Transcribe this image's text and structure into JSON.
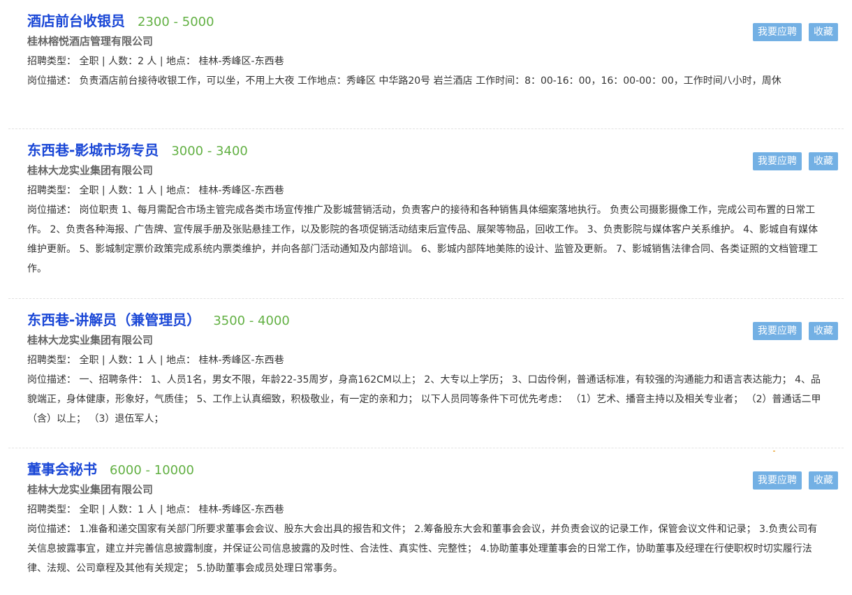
{
  "jobs": [
    {
      "title": "酒店前台收银员",
      "salary": "2300 - 5000",
      "company": "桂林榕悦酒店管理有限公司",
      "meta": "招聘类型： 全职 | 人数：2 人 | 地点： 桂林-秀峰区-东西巷",
      "desc": "岗位描述： 负责酒店前台接待收银工作，可以坐，不用上大夜 工作地点：秀峰区 中华路20号 岩兰酒店 工作时间：8：00-16：00，16：00-00：00，工作时间八小时，周休",
      "apply_label": "我要应聘",
      "save_label": "收藏"
    },
    {
      "title": "东西巷-影城市场专员",
      "salary": "3000 - 3400",
      "company": "桂林大龙实业集团有限公司",
      "meta": "招聘类型： 全职 | 人数：1 人 | 地点： 桂林-秀峰区-东西巷",
      "desc": "岗位描述： 岗位职责 1、每月需配合市场主管完成各类市场宣传推广及影城营销活动，负责客户的接待和各种销售具体细案落地执行。 负责公司摄影摄像工作，完成公司布置的日常工作。 2、负责各种海报、广告牌、宣传展手册及张贴悬挂工作，以及影院的各项促销活动结束后宣传品、展架等物品，回收工作。 3、负责影院与媒体客户关系维护。 4、影城自有媒体维护更新。 5、影城制定票价政策完成系统内票类维护，并向各部门活动通知及内部培训。 6、影城内部阵地美陈的设计、监管及更新。 7、影城销售法律合同、各类证照的文档管理工作。",
      "apply_label": "我要应聘",
      "save_label": "收藏"
    },
    {
      "title": "东西巷-讲解员（兼管理员）",
      "salary": "3500 - 4000",
      "company": "桂林大龙实业集团有限公司",
      "meta": "招聘类型： 全职 | 人数：1 人 | 地点： 桂林-秀峰区-东西巷",
      "desc": "岗位描述： 一、招聘条件： 1、人员1名，男女不限，年龄22-35周岁，身高162CM以上； 2、大专以上学历； 3、口齿伶俐，普通话标准，有较强的沟通能力和语言表达能力； 4、品貌端正，身体健康，形象好，气质佳； 5、工作上认真细致，积极敬业，有一定的亲和力； 以下人员同等条件下可优先考虑： （1）艺术、播音主持以及相关专业者； （2）普通话二甲（含）以上； （3）退伍军人；",
      "apply_label": "我要应聘",
      "save_label": "收藏"
    },
    {
      "title": "董事会秘书",
      "salary": "6000 - 10000",
      "company": "桂林大龙实业集团有限公司",
      "meta": "招聘类型： 全职 | 人数：1 人 | 地点： 桂林-秀峰区-东西巷",
      "desc": "岗位描述： 1.准备和递交国家有关部门所要求董事会会议、股东大会出具的报告和文件； 2.筹备股东大会和董事会会议，并负责会议的记录工作，保管会议文件和记录； 3.负责公司有关信息披露事宜，建立并完善信息披露制度，并保证公司信息披露的及时性、合法性、真实性、完整性； 4.协助董事处理董事会的日常工作，协助董事及经理在行使职权时切实履行法律、法规、公司章程及其他有关规定； 5.协助董事会成员处理日常事务。",
      "apply_label": "我要应聘",
      "save_label": "收藏"
    }
  ]
}
